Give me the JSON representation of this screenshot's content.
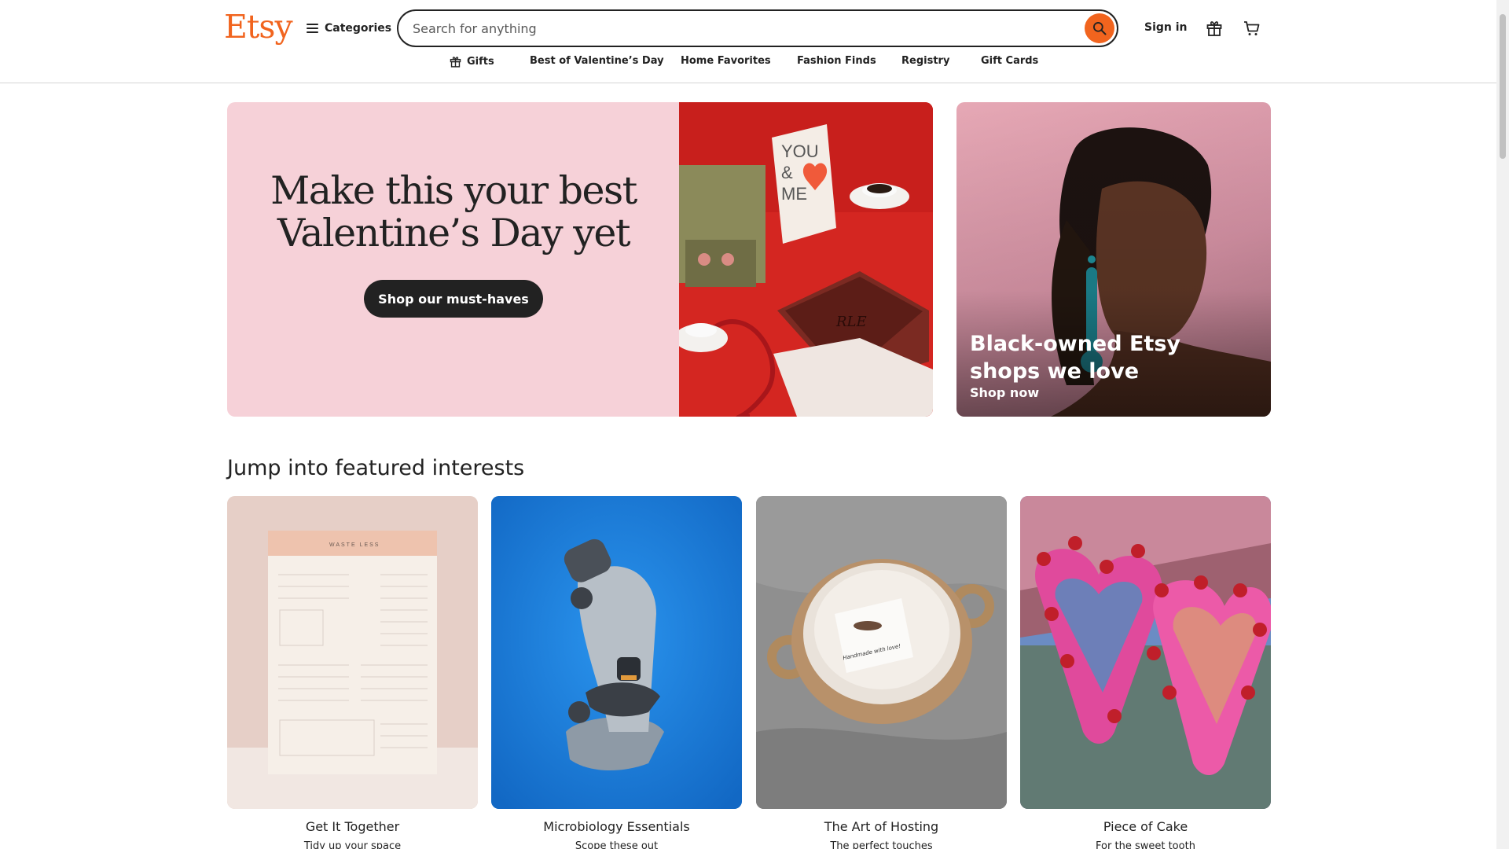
{
  "header": {
    "logo": "Etsy",
    "categories_label": "Categories",
    "search_placeholder": "Search for anything",
    "signin_label": "Sign in",
    "icons": [
      "menu-icon",
      "search-icon",
      "gift-icon",
      "cart-icon"
    ]
  },
  "subnav": [
    {
      "label": "Gifts",
      "icon": "gift-icon"
    },
    {
      "label": "Best of Valentine’s Day"
    },
    {
      "label": "Home Favorites"
    },
    {
      "label": "Fashion Finds"
    },
    {
      "label": "Registry"
    },
    {
      "label": "Gift Cards"
    }
  ],
  "hero": {
    "title_line1": "Make this your best",
    "title_line2": "Valentine’s Day yet",
    "button_label": "Shop our must-haves",
    "card_text": [
      "YOU",
      "&",
      "ME"
    ],
    "tray_text": "RLE",
    "bg_color": "#f6d1d8"
  },
  "side_promo": {
    "title": "Black-owned Etsy shops we love",
    "link": "Shop now"
  },
  "featured": {
    "title": "Jump into featured interests",
    "cards": [
      {
        "title": "Get It Together",
        "subtitle": "Tidy up your space",
        "planner_title": "WASTE LESS"
      },
      {
        "title": "Microbiology Essentials",
        "subtitle": "Scope these out"
      },
      {
        "title": "The Art of Hosting",
        "subtitle": "The perfect touches",
        "note": "Handmade with love!"
      },
      {
        "title": "Piece of Cake",
        "subtitle": "For the sweet tooth"
      }
    ]
  },
  "colors": {
    "brand": "#f1641e",
    "text": "#222222"
  }
}
